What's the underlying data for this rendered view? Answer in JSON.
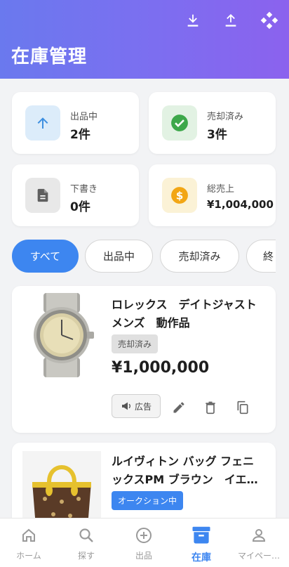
{
  "header": {
    "title": "在庫管理",
    "icons": [
      "download-icon",
      "upload-icon",
      "grid-icon"
    ]
  },
  "stats": [
    {
      "label": "出品中",
      "value": "2件",
      "icon": "arrow-up-icon"
    },
    {
      "label": "売却済み",
      "value": "3件",
      "icon": "check-circle-icon"
    },
    {
      "label": "下書き",
      "value": "0件",
      "icon": "document-icon"
    },
    {
      "label": "総売上",
      "value": "¥1,004,000",
      "icon": "dollar-coin-icon"
    }
  ],
  "filters": [
    "すべて",
    "出品中",
    "売却済み",
    "終"
  ],
  "products": [
    {
      "name": "ロレックス　デイトジャスト\nメンズ　動作品",
      "status": "売却済み",
      "price": "¥1,000,000",
      "ad_label": "広告"
    },
    {
      "name": "ルイヴィトン バッグ フェニ\nックスPM ブラウン　イエ…",
      "status": "オークション中"
    }
  ],
  "nav": [
    {
      "label": "ホーム",
      "icon": "home-icon"
    },
    {
      "label": "探す",
      "icon": "search-icon"
    },
    {
      "label": "出品",
      "icon": "add-circle-icon"
    },
    {
      "label": "在庫",
      "icon": "inventory-icon"
    },
    {
      "label": "マイペー…",
      "icon": "person-icon"
    }
  ],
  "colors": {
    "accent": "#3d86f0",
    "header_start": "#6a79ee",
    "header_end": "#8b62ee"
  }
}
